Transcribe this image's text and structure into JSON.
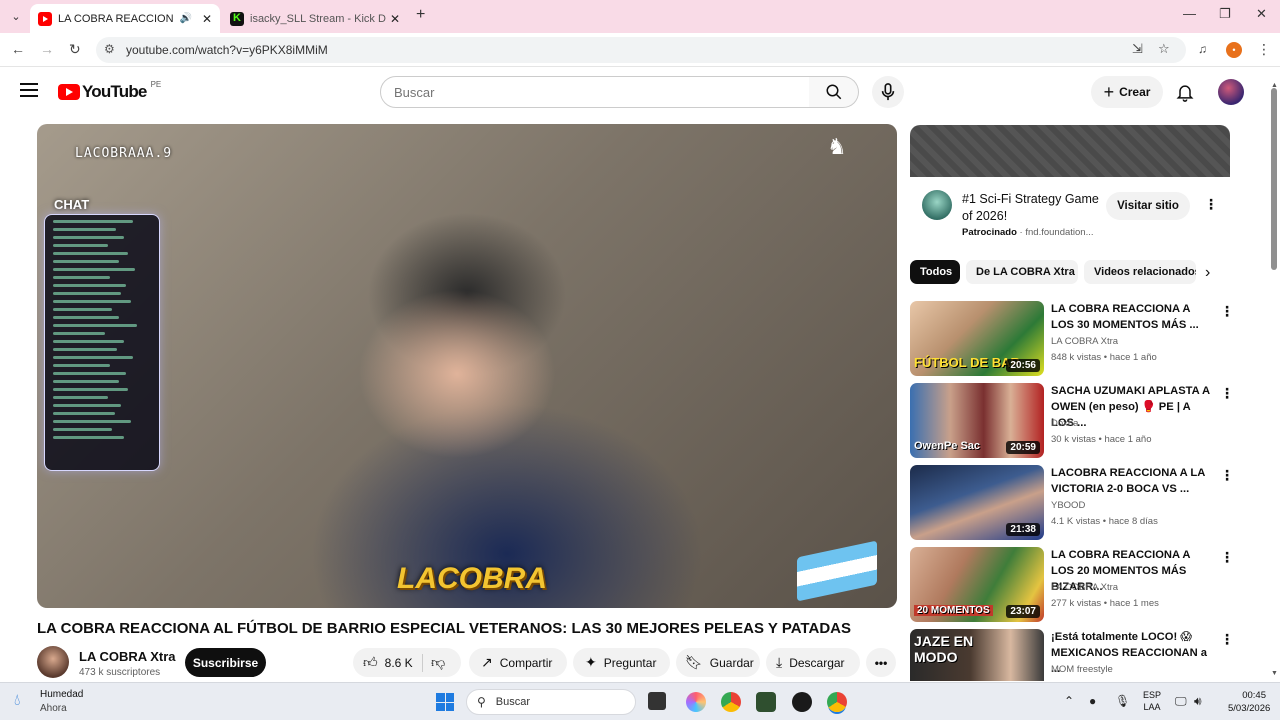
{
  "browser": {
    "tabs": [
      {
        "title": "LA COBRA REACCIONA AL FÚTBOL",
        "active": true
      },
      {
        "title": "isacky_SLL Stream - Kick Dashboard",
        "active": false
      }
    ],
    "url": "youtube.com/watch?v=y6PKX8iMMiM"
  },
  "header": {
    "logo_text": "YouTube",
    "country_code": "PE",
    "search_placeholder": "Buscar",
    "create_label": "Crear"
  },
  "player": {
    "overlay_name": "LACOBRAAA.9",
    "chat_label": "CHAT",
    "brand_text": "LACOBRA"
  },
  "video": {
    "title": "LA COBRA REACCIONA AL FÚTBOL DE BARRIO ESPECIAL VETERANOS: LAS 30 MEJORES PELEAS Y PATADAS",
    "channel": "LA COBRA Xtra",
    "subscribers": "473 k suscriptores",
    "subscribe_label": "Suscribirse",
    "likes": "8.6 K",
    "share_label": "Compartir",
    "ask_label": "Preguntar",
    "save_label": "Guardar",
    "download_label": "Descargar"
  },
  "ad": {
    "title": "#1 Sci-Fi Strategy Game of 2026!",
    "sponsored": "Patrocinado",
    "domain": "fnd.foundation...",
    "visit_label": "Visitar sitio"
  },
  "chips": [
    "Todos",
    "De LA COBRA Xtra",
    "Videos relacionados"
  ],
  "recommendations": [
    {
      "title": "LA COBRA REACCIONA A LOS 30 MOMENTOS MÁS ...",
      "channel": "LA COBRA Xtra",
      "meta": "848 k vistas • hace 1 año",
      "duration": "20:56",
      "thumb_text": "FÚTBOL DE BAR"
    },
    {
      "title": "SACHA UZUMAKI APLASTA A OWEN (en peso) 🥊 PE | A LOS ...",
      "channel": "Doxha",
      "meta": "30 k vistas • hace 1 año",
      "duration": "20:59",
      "thumb_text": "OwenPe   Sac"
    },
    {
      "title": "LACOBRA REACCIONA A LA VICTORIA 2-0 BOCA VS ...",
      "channel": "YBOOD",
      "meta": "4.1 K vistas • hace 8 días",
      "duration": "21:38",
      "thumb_text": ""
    },
    {
      "title": "LA COBRA REACCIONA A LOS 20 MOMENTOS MÁS BIZARR...",
      "channel": "LA COBRA Xtra",
      "meta": "277 k vistas • hace 1 mes",
      "duration": "23:07",
      "thumb_text": "20 MOMENTOS"
    },
    {
      "title": "¡Está totalmente LOCO! 😱 MEXICANOS REACCIONAN a ...",
      "channel": "MOM freestyle",
      "meta": "",
      "duration": "",
      "thumb_text": "JAZE EN MODO"
    }
  ],
  "taskbar": {
    "weather_title": "Humedad",
    "weather_sub": "Ahora",
    "search_label": "Buscar",
    "lang_1": "ESP",
    "lang_2": "LAA",
    "time": "00:45",
    "date": "5/03/2026"
  }
}
